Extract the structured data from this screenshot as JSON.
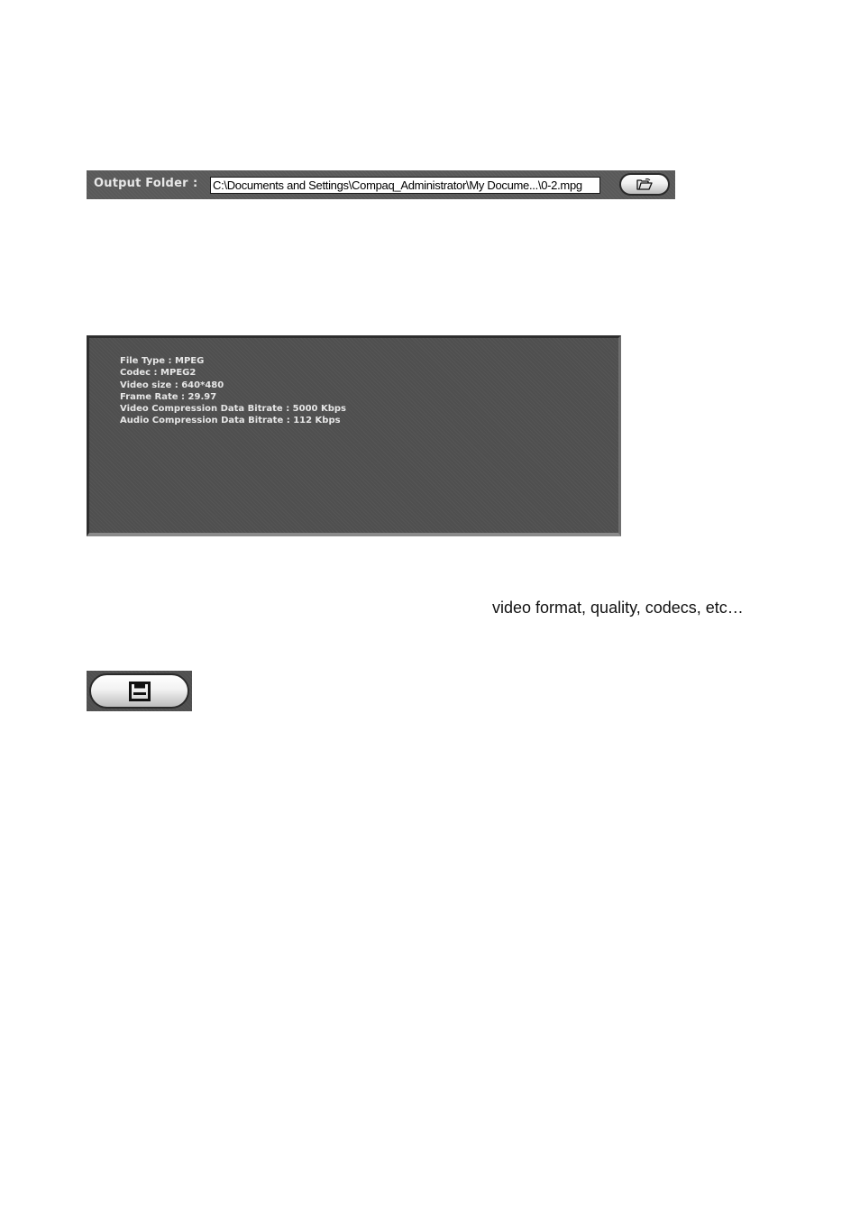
{
  "output_folder": {
    "label": "Output Folder",
    "separator": ":",
    "path": "C:\\Documents and Settings\\Compaq_Administrator\\My Docume...\\0-2.mpg",
    "browse_icon": "open-folder-icon"
  },
  "info_panel": {
    "lines": [
      "File Type : MPEG",
      "Codec : MPEG2",
      "Video size : 640*480",
      "Frame Rate : 29.97",
      "Video Compression Data Bitrate : 5000 Kbps",
      "Audio Compression Data Bitrate : 112 Kbps"
    ]
  },
  "caption": "video format, quality, codecs, etc…",
  "save_button": {
    "icon": "floppy-disk-icon"
  }
}
